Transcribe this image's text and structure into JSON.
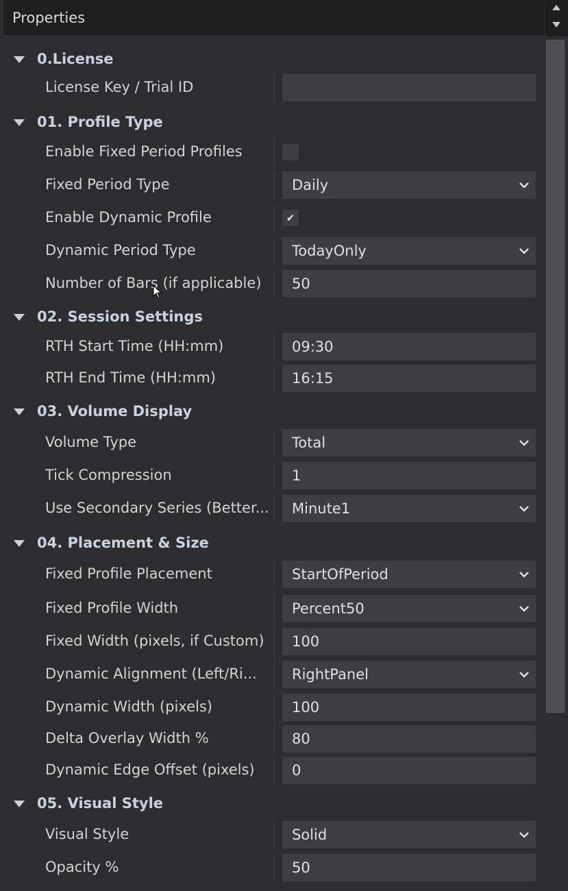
{
  "panel": {
    "title": "Properties"
  },
  "categories": [
    {
      "label": "0.License",
      "props": [
        {
          "label": "License Key / Trial ID",
          "type": "text",
          "value": ""
        }
      ]
    },
    {
      "label": "01. Profile Type",
      "props": [
        {
          "label": "Enable Fixed Period Profiles",
          "type": "checkbox",
          "checked": false
        },
        {
          "label": "Fixed Period Type",
          "type": "dropdown",
          "value": "Daily"
        },
        {
          "label": "Enable Dynamic Profile",
          "type": "checkbox",
          "checked": true
        },
        {
          "label": "Dynamic Period Type",
          "type": "dropdown",
          "value": "TodayOnly"
        },
        {
          "label": "Number of Bars (if applicable)",
          "type": "text",
          "value": "50"
        }
      ]
    },
    {
      "label": "02. Session Settings",
      "props": [
        {
          "label": "RTH Start Time (HH:mm)",
          "type": "text",
          "value": "09:30"
        },
        {
          "label": "RTH End Time (HH:mm)",
          "type": "text",
          "value": "16:15"
        }
      ]
    },
    {
      "label": "03. Volume Display",
      "props": [
        {
          "label": "Volume Type",
          "type": "dropdown",
          "value": "Total"
        },
        {
          "label": "Tick Compression",
          "type": "text",
          "value": "1"
        },
        {
          "label": "Use Secondary Series (Better...",
          "type": "dropdown",
          "value": "Minute1"
        }
      ]
    },
    {
      "label": "04. Placement & Size",
      "props": [
        {
          "label": "Fixed Profile Placement",
          "type": "dropdown",
          "value": "StartOfPeriod"
        },
        {
          "label": "Fixed Profile Width",
          "type": "dropdown",
          "value": "Percent50"
        },
        {
          "label": "Fixed Width (pixels, if Custom)",
          "type": "text",
          "value": "100"
        },
        {
          "label": "Dynamic Alignment (Left/Ri...",
          "type": "dropdown",
          "value": "RightPanel"
        },
        {
          "label": "Dynamic Width (pixels)",
          "type": "text",
          "value": "100"
        },
        {
          "label": "Delta Overlay Width %",
          "type": "text",
          "value": "80"
        },
        {
          "label": "Dynamic Edge Offset (pixels)",
          "type": "text",
          "value": "0"
        }
      ]
    },
    {
      "label": "05. Visual Style",
      "props": [
        {
          "label": "Visual Style",
          "type": "dropdown",
          "value": "Solid"
        },
        {
          "label": "Opacity %",
          "type": "text",
          "value": "50"
        }
      ]
    }
  ],
  "icons": {
    "expand": "triangle-down-icon",
    "dropdown": "chevron-down-icon",
    "check": "checkmark-icon",
    "cursor": "mouse-pointer-icon"
  },
  "colors": {
    "panel_bg": "#2d2d30",
    "header_bg": "#1e1e1e",
    "field_bg": "#3e3e42",
    "category_text": "#c9d3df"
  }
}
